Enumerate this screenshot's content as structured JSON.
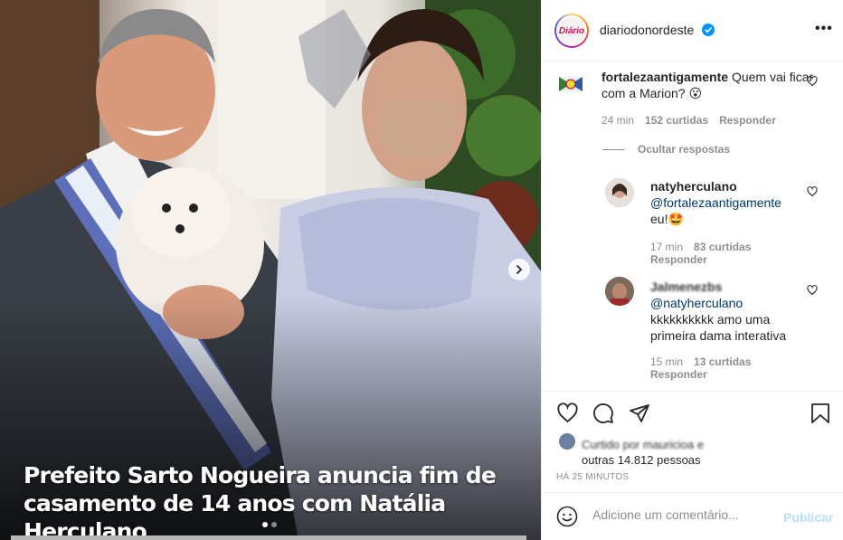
{
  "post": {
    "caption_line1": "Prefeito Sarto Nogueira anuncia fim de",
    "caption_line2": "casamento de 14 anos com Natália Herculano",
    "slides_count": 2,
    "active_slide": 1
  },
  "header": {
    "avatar_text": "Diário",
    "username": "diariodonordeste",
    "verified": true,
    "more_icon": "more-horizontal-icon"
  },
  "comments": [
    {
      "username": "fortalezaantigamente",
      "text": "Quem vai ficar com a Marion? 😮",
      "time": "24 min",
      "likes": "152 curtidas",
      "reply": "Responder"
    },
    {
      "username": "natyherculano",
      "mention": "@fortalezaantigamente",
      "text": "eu!🤩",
      "time": "17 min",
      "likes": "83 curtidas",
      "reply": "Responder"
    },
    {
      "username": "Jalmenezbs",
      "mention": "@natyherculano",
      "text_line1": "kkkkkkkkkk amo uma",
      "text_line2": "primeira dama interativa",
      "time": "15 min",
      "likes": "13 curtidas",
      "reply": "Responder"
    }
  ],
  "hide_replies": "Ocultar respostas",
  "likes": {
    "line1_blurred": "Curtido por mauricioa e",
    "line2": "outras 14.812 pessoas"
  },
  "timestamp": "Há 25 minutos",
  "add_comment": {
    "placeholder": "Adicione um comentário...",
    "publish": "Publicar"
  },
  "colors": {
    "link_blue": "#00376b",
    "verified_blue": "#0095f6",
    "publish_disabled": "#b2dffc",
    "muted": "#8e8e8e"
  }
}
